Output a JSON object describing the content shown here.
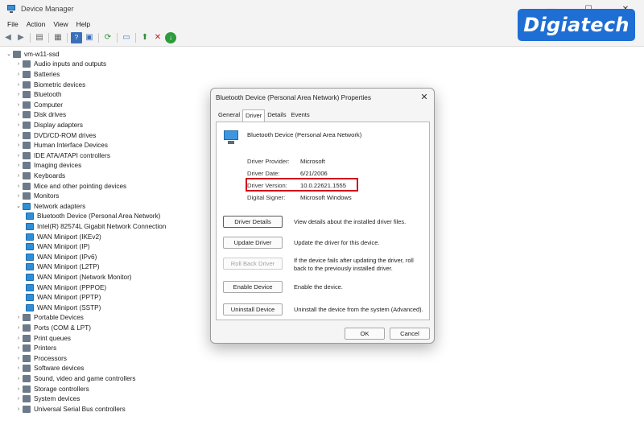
{
  "window": {
    "title": "Device Manager",
    "controls": [
      "—",
      "☐",
      "✕"
    ]
  },
  "menu": [
    "File",
    "Action",
    "View",
    "Help"
  ],
  "tree": {
    "root": "vm-w11-ssd",
    "categories_top": [
      "Audio inputs and outputs",
      "Batteries",
      "Biometric devices",
      "Bluetooth",
      "Computer",
      "Disk drives",
      "Display adapters",
      "DVD/CD-ROM drives",
      "Human Interface Devices",
      "IDE ATA/ATAPI controllers",
      "Imaging devices",
      "Keyboards",
      "Mice and other pointing devices",
      "Monitors"
    ],
    "expanded_category": "Network adapters",
    "network_adapters": [
      "Bluetooth Device (Personal Area Network)",
      "Intel(R) 82574L Gigabit Network Connection",
      "WAN Miniport (IKEv2)",
      "WAN Miniport (IP)",
      "WAN Miniport (IPv6)",
      "WAN Miniport (L2TP)",
      "WAN Miniport (Network Monitor)",
      "WAN Miniport (PPPOE)",
      "WAN Miniport (PPTP)",
      "WAN Miniport (SSTP)"
    ],
    "categories_bottom": [
      "Portable Devices",
      "Ports (COM & LPT)",
      "Print queues",
      "Printers",
      "Processors",
      "Software devices",
      "Sound, video and game controllers",
      "Storage controllers",
      "System devices",
      "Universal Serial Bus controllers"
    ]
  },
  "watermark": "Digiatech",
  "dialog": {
    "title": "Bluetooth Device (Personal Area Network) Properties",
    "tabs": [
      "General",
      "Driver",
      "Details",
      "Events"
    ],
    "device_name": "Bluetooth Device (Personal Area Network)",
    "fields": [
      {
        "label": "Driver Provider:",
        "value": "Microsoft"
      },
      {
        "label": "Driver Date:",
        "value": "6/21/2006"
      },
      {
        "label": "Driver Version:",
        "value": "10.0.22621.1555"
      },
      {
        "label": "Digital Signer:",
        "value": "Microsoft Windows"
      }
    ],
    "buttons": [
      {
        "label": "Driver Details",
        "desc": "View details about the installed driver files."
      },
      {
        "label": "Update Driver",
        "desc": "Update the driver for this device."
      },
      {
        "label": "Roll Back Driver",
        "desc": "If the device fails after updating the driver, roll back to the previously installed driver."
      },
      {
        "label": "Enable Device",
        "desc": "Enable the device."
      },
      {
        "label": "Uninstall Device",
        "desc": "Uninstall the device from the system (Advanced)."
      }
    ],
    "ok": "OK",
    "cancel": "Cancel"
  },
  "colors": {
    "highlight": "#d0121b",
    "watermark_bg": "#1f6ed4",
    "network_icon": "#2e8fd8"
  }
}
